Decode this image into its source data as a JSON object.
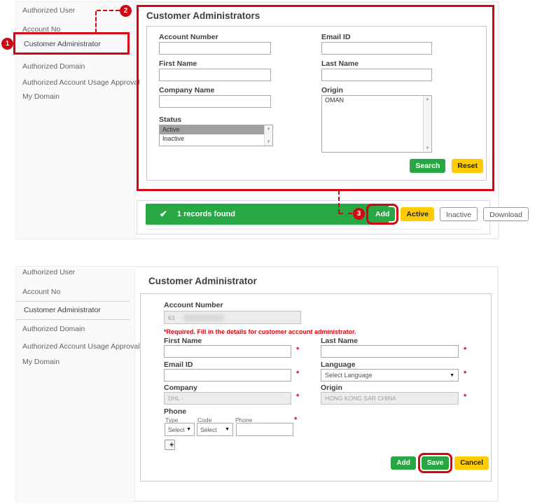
{
  "colors": {
    "brand_red": "#d40511",
    "green": "#28a745",
    "yellow": "#ffcc00"
  },
  "icons": {
    "check": "✔",
    "dropdown": "▼",
    "scroll_up": "▲",
    "scroll_down": "▼"
  },
  "markers": {
    "required": "*"
  },
  "sidebar": {
    "items": [
      "Authorized User",
      "Account No",
      "Customer Administrator",
      "Authorized Domain",
      "Authorized Account Usage Approval",
      "My Domain"
    ]
  },
  "annotations": {
    "step1": "1",
    "step2": "2",
    "step3": "3"
  },
  "search_panel": {
    "title": "Customer Administrators",
    "labels": {
      "account_number": "Account Number",
      "email_id": "Email ID",
      "first_name": "First Name",
      "last_name": "Last Name",
      "company_name": "Company Name",
      "origin": "Origin",
      "status": "Status"
    },
    "origin_options": [
      "OMAN"
    ],
    "status_options": [
      "Active",
      "Inactive"
    ],
    "status_selected": "Active",
    "buttons": {
      "search": "Search",
      "reset": "Reset"
    }
  },
  "results_bar": {
    "message": "1 records found",
    "buttons": {
      "add": "Add",
      "active": "Active",
      "inactive": "Inactive",
      "download": "Download"
    }
  },
  "detail_panel": {
    "title": "Customer Administrator",
    "labels": {
      "account_number": "Account Number",
      "first_name": "First Name",
      "last_name": "Last Name",
      "email_id": "Email ID",
      "language": "Language",
      "company": "Company",
      "origin": "Origin",
      "phone": "Phone",
      "phone_type": "Type",
      "phone_code": "Code",
      "phone_number": "Phone"
    },
    "values": {
      "account_number": "63",
      "language": "Select Language",
      "company": "DHL -",
      "origin": "HONG KONG SAR CHINA",
      "phone_type": "Select",
      "phone_code": "Select"
    },
    "required_note": "*Required. Fill in the details for customer account administrator.",
    "buttons": {
      "add": "Add",
      "save": "Save",
      "cancel": "Cancel",
      "add_phone": "+"
    }
  }
}
